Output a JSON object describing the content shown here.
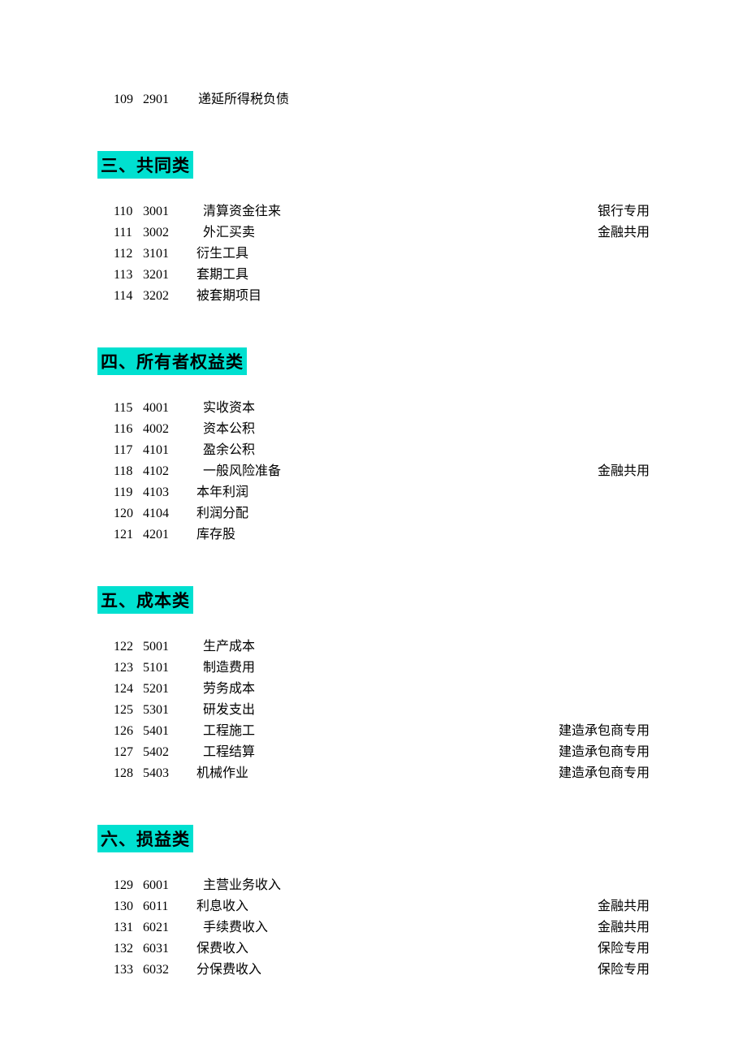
{
  "top_rows": [
    {
      "seq": "109",
      "code": "2901",
      "name": "递延所得税负债",
      "note": ""
    }
  ],
  "sections": [
    {
      "title": "三、共同类",
      "rows": [
        {
          "seq": "110",
          "code": "3001",
          "name": "清算资金往来",
          "note": "银行专用",
          "indent": "a"
        },
        {
          "seq": "111",
          "code": "3002",
          "name": "外汇买卖",
          "note": "金融共用",
          "indent": "a"
        },
        {
          "seq": "112",
          "code": "3101",
          "name": "衍生工具",
          "note": "",
          "indent": "c"
        },
        {
          "seq": "113",
          "code": "3201",
          "name": "套期工具",
          "note": "",
          "indent": "c"
        },
        {
          "seq": "114",
          "code": "3202",
          "name": "被套期项目",
          "note": "",
          "indent": "c"
        }
      ]
    },
    {
      "title": "四、所有者权益类",
      "rows": [
        {
          "seq": "115",
          "code": "4001",
          "name": "实收资本",
          "note": "",
          "indent": "a"
        },
        {
          "seq": "116",
          "code": "4002",
          "name": "资本公积",
          "note": "",
          "indent": "a"
        },
        {
          "seq": "117",
          "code": "4101",
          "name": "盈余公积",
          "note": "",
          "indent": "a"
        },
        {
          "seq": "118",
          "code": "4102",
          "name": "一般风险准备",
          "note": "金融共用",
          "indent": "a"
        },
        {
          "seq": "119",
          "code": "4103",
          "name": "本年利润",
          "note": "",
          "indent": "c"
        },
        {
          "seq": "120",
          "code": "4104",
          "name": "利润分配",
          "note": "",
          "indent": "c"
        },
        {
          "seq": "121",
          "code": "4201",
          "name": "库存股",
          "note": "",
          "indent": "c"
        }
      ]
    },
    {
      "title": "五、成本类",
      "rows": [
        {
          "seq": "122",
          "code": "5001",
          "name": "生产成本",
          "note": "",
          "indent": "a"
        },
        {
          "seq": "123",
          "code": "5101",
          "name": "制造费用",
          "note": "",
          "indent": "a"
        },
        {
          "seq": "124",
          "code": "5201",
          "name": "劳务成本",
          "note": "",
          "indent": "a"
        },
        {
          "seq": "125",
          "code": "5301",
          "name": "研发支出",
          "note": "",
          "indent": "a"
        },
        {
          "seq": "126",
          "code": "5401",
          "name": "工程施工",
          "note": "建造承包商专用",
          "indent": "a"
        },
        {
          "seq": "127",
          "code": "5402",
          "name": "工程结算",
          "note": "建造承包商专用",
          "indent": "a"
        },
        {
          "seq": "128",
          "code": "5403",
          "name": "机械作业",
          "note": "建造承包商专用",
          "indent": "c"
        }
      ]
    },
    {
      "title": "六、损益类",
      "rows": [
        {
          "seq": "129",
          "code": "6001",
          "name": "主营业务收入",
          "note": "",
          "indent": "a"
        },
        {
          "seq": "130",
          "code": "6011",
          "name": "利息收入",
          "note": "金融共用",
          "indent": "c",
          "noteClass": ""
        },
        {
          "seq": "131",
          "code": "6021",
          "name": "手续费收入",
          "note": "金融共用",
          "indent": "a",
          "noteClass": "note-shift"
        },
        {
          "seq": "132",
          "code": "6031",
          "name": "保费收入",
          "note": "保险专用",
          "indent": "c",
          "noteClass": ""
        },
        {
          "seq": "133",
          "code": "6032",
          "name": "分保费收入",
          "note": "保险专用",
          "indent": "c",
          "noteClass": "note-shift"
        }
      ]
    }
  ]
}
